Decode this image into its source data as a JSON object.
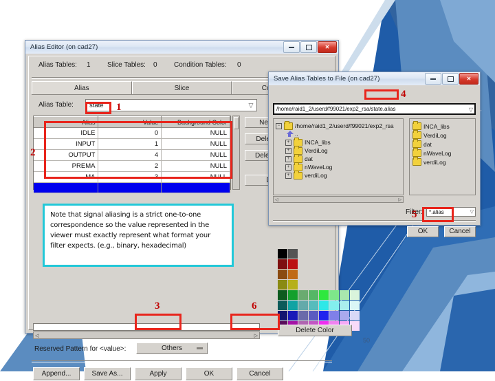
{
  "slide": {
    "number": "50"
  },
  "alias_editor": {
    "title": "Alias Editor (on cad27)",
    "window_buttons": {
      "minimize": "minimize-icon",
      "maximize": "maximize-icon",
      "close": "✕"
    },
    "counts": [
      {
        "label": "Alias Tables:",
        "value": "1"
      },
      {
        "label": "Slice Tables:",
        "value": "0"
      },
      {
        "label": "Condition Tables:",
        "value": "0"
      }
    ],
    "tabs": [
      {
        "label": "Alias",
        "selected": true
      },
      {
        "label": "Slice",
        "selected": false
      },
      {
        "label": "Conditional A",
        "selected": false
      }
    ],
    "alias_table_label": "Alias Table:",
    "alias_table_value": "state",
    "grid": {
      "columns": [
        "Alias",
        "Value",
        "Background Color"
      ],
      "rows": [
        [
          "IDLE",
          "0",
          "NULL"
        ],
        [
          "INPUT",
          "1",
          "NULL"
        ],
        [
          "OUTPUT",
          "4",
          "NULL"
        ],
        [
          "PREMA",
          "2",
          "NULL"
        ],
        [
          "MA",
          "3",
          "NULL"
        ]
      ]
    },
    "side_buttons": [
      {
        "label": "New..."
      },
      {
        "label": "Delete..."
      },
      {
        "label": "Delete ..."
      },
      {
        "label": "D"
      }
    ],
    "note": "Note that signal aliasing is a strict one-to-one correspondence so the value represented in the viewer must exactly represent what format your filter expects. (e.g., binary, hexadecimal)",
    "delete_color_label": "Delete Color",
    "reserved_label": "Reserved Pattern for <value>:",
    "reserved_value": "Others",
    "footer_buttons": [
      {
        "label": "Append..."
      },
      {
        "label": "Save As..."
      },
      {
        "label": "Apply"
      },
      {
        "label": "OK"
      },
      {
        "label": "Cancel"
      }
    ],
    "palette_rows": [
      [
        "#000000",
        "#545454"
      ],
      [
        "#7e1010",
        "#bb1212"
      ],
      [
        "#8a4a10",
        "#c06a16"
      ],
      [
        "#8a8a12",
        "#b6b01a"
      ],
      [
        "#0d5a1e",
        "#13a02c",
        "#6aab70",
        "#55b766",
        "#2ee83e",
        "#7ee78a",
        "#a9e8ae",
        "#d9f4dc"
      ],
      [
        "#0d5a5a",
        "#11a3a3",
        "#63aaaa",
        "#56bcbc",
        "#2ee8e8",
        "#83eeee",
        "#aaeeee",
        "#dbf6f6"
      ],
      [
        "#141470",
        "#1a1ab8",
        "#6a6aaa",
        "#5b5bc1",
        "#2222ee",
        "#8080e8",
        "#a9a9ee",
        "#d8d8f7"
      ],
      [
        "#5a0d5a",
        "#a412a4",
        "#b065b0",
        "#c356c3",
        "#ee2eee",
        "#f083f0",
        "#f5aaf5",
        "#f9dbf9"
      ]
    ]
  },
  "save_dialog": {
    "title": "Save Alias Tables to File (on cad27)",
    "path_value": "/home/raid1_2/userd/f99021/exp2_rsa/state.alias",
    "tree": {
      "root": "/home/raid1_2/userd/f99021/exp2_rsa",
      "parent": "..",
      "children": [
        "INCA_libs",
        "VerdiLog",
        "dat",
        "nWaveLog",
        "verdiLog"
      ]
    },
    "files": [
      "INCA_libs",
      "VerdiLog",
      "dat",
      "nWaveLog",
      "verdiLog"
    ],
    "filter_label": "Filter:",
    "filter_value": "*.alias",
    "buttons": [
      {
        "label": "OK"
      },
      {
        "label": "Cancel"
      }
    ]
  },
  "annotations": {
    "numbers": [
      {
        "id": "1",
        "text": "1"
      },
      {
        "id": "2",
        "text": "2"
      },
      {
        "id": "3",
        "text": "3"
      },
      {
        "id": "4",
        "text": "4"
      },
      {
        "id": "5",
        "text": "5"
      },
      {
        "id": "6",
        "text": "6"
      }
    ],
    "highlight_color": "#e8251c",
    "note_border_color": "#22c8d8"
  }
}
